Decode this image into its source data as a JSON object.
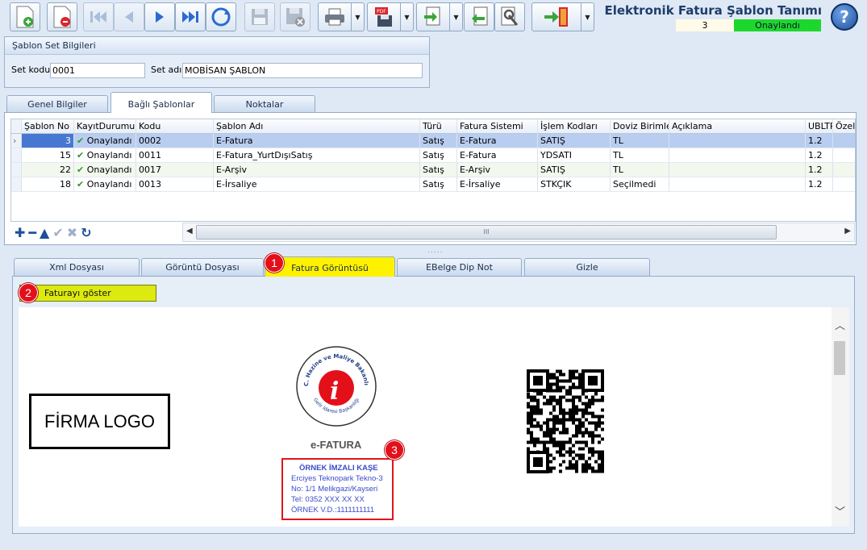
{
  "window": {
    "title": "Elektronik Fatura Şablon Tanımı",
    "record_count": "3",
    "status": "Onaylandı",
    "help_label": "?"
  },
  "toolbar": {
    "buttons": [
      "new-record-icon",
      "delete-record-icon",
      "first-record-icon",
      "previous-record-icon",
      "next-record-icon",
      "last-record-icon",
      "refresh-icon",
      "save-icon",
      "cancel-save-icon",
      "print-icon",
      "pdf-export-icon",
      "import-icon",
      "export-icon",
      "settings-icon",
      "exit-icon"
    ]
  },
  "group": {
    "title": "Şablon Set Bilgileri",
    "set_kodu_label": "Set kodu",
    "set_kodu_value": "0001",
    "set_adi_label": "Set adı",
    "set_adi_value": "MOBİSAN ŞABLON"
  },
  "tabs": {
    "genel": "Genel Bilgiler",
    "bagli": "Bağlı Şablonlar",
    "noktalar": "Noktalar"
  },
  "grid": {
    "columns": [
      "Şablon No",
      "KayıtDurumu",
      "Kodu",
      "Şablon Adı",
      "Türü",
      "Fatura Sistemi",
      "İşlem Kodları",
      "Doviz Birimleri",
      "Açıklama",
      "UBLTR",
      "Özel F"
    ],
    "rows": [
      {
        "no": "3",
        "durum": "Onaylandı",
        "kodu": "0002",
        "adi": "E-Fatura",
        "turu": "Satış",
        "sistem": "E-Fatura",
        "islem": "SATIŞ",
        "doviz": "TL",
        "aciklama": "",
        "ubltr": "1.2"
      },
      {
        "no": "15",
        "durum": "Onaylandı",
        "kodu": "0011",
        "adi": "E-Fatura_YurtDışıSatış",
        "turu": "Satış",
        "sistem": "E-Fatura",
        "islem": "YDSATI",
        "doviz": "TL",
        "aciklama": "",
        "ubltr": "1.2"
      },
      {
        "no": "22",
        "durum": "Onaylandı",
        "kodu": "0017",
        "adi": "E-Arşiv",
        "turu": "Satış",
        "sistem": "E-Arşiv",
        "islem": "SATIŞ",
        "doviz": "TL",
        "aciklama": "",
        "ubltr": "1.2"
      },
      {
        "no": "18",
        "durum": "Onaylandı",
        "kodu": "0013",
        "adi": "E-İrsaliye",
        "turu": "Satış",
        "sistem": "E-İrsaliye",
        "islem": "STKÇIK",
        "doviz": "Seçilmedi",
        "aciklama": "",
        "ubltr": "1.2"
      }
    ],
    "scroll_label": "III"
  },
  "lower_tabs": {
    "xml": "Xml Dosyası",
    "goruntu": "Görüntü Dosyası",
    "fatura": "Fatura Görüntüsü",
    "ebelge": "EBelge Dip Not",
    "gizle": "Gizle"
  },
  "preview": {
    "show_button": "Faturayı göster",
    "firm_logo": "FİRMA LOGO",
    "seal_top_text": "T.C. Hazine ve Maliye Bakanlığı",
    "seal_bottom_text": "Gelir İdaresi Başkanlığı",
    "efatura_label": "e-FATURA",
    "stamp": {
      "title": "ÖRNEK İMZALI KAŞE",
      "line1": "Erciyes Teknopark Tekno-3",
      "line2": "No: 1/1 Melikgazi/Kayseri",
      "line3": "Tel: 0352 XXX XX XX",
      "line4": "ÖRNEK V.D.:1111111111"
    }
  },
  "callouts": [
    "1",
    "2",
    "3"
  ],
  "colors": {
    "status_green": "#1dd82c",
    "highlight_yellow": "#fff200",
    "callout_red": "#e3101a",
    "selected_row": "#4778d1"
  }
}
